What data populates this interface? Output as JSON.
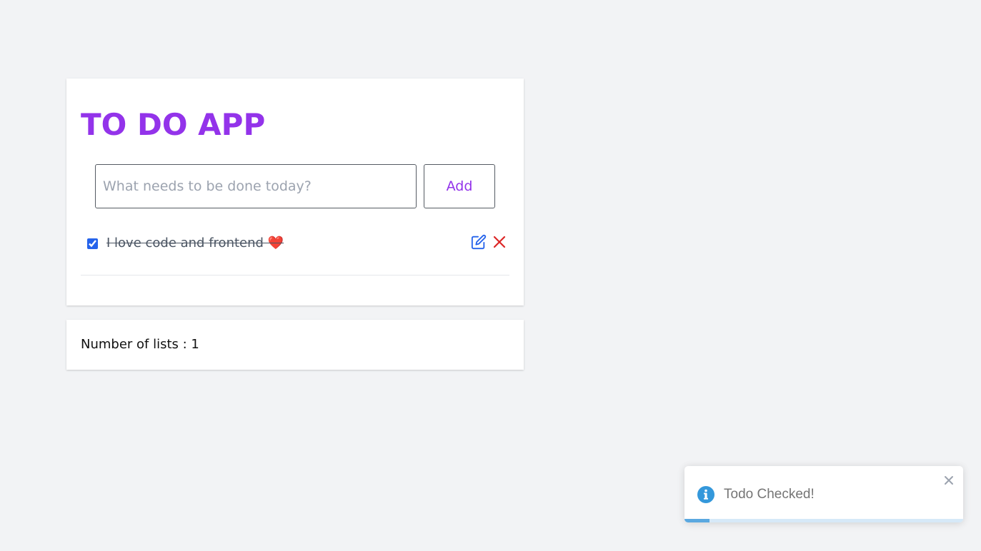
{
  "app": {
    "title": "TO DO APP"
  },
  "form": {
    "input_value": "",
    "input_placeholder": "What needs to be done today?",
    "add_label": "Add"
  },
  "todos": [
    {
      "text": "I love code and frontend ❤️",
      "checked": true,
      "edit_icon": "edit-icon",
      "delete_icon": "close-icon"
    }
  ],
  "footer": {
    "count_text": "Number of lists : 1"
  },
  "toast": {
    "message": "Todo Checked!",
    "icon": "info-icon",
    "close_icon": "close-icon",
    "progress": 0.09
  },
  "colors": {
    "accent": "#9333ea",
    "edit": "#2563eb",
    "delete": "#dc2626",
    "info": "#3498db",
    "background": "#f2f3f5"
  }
}
